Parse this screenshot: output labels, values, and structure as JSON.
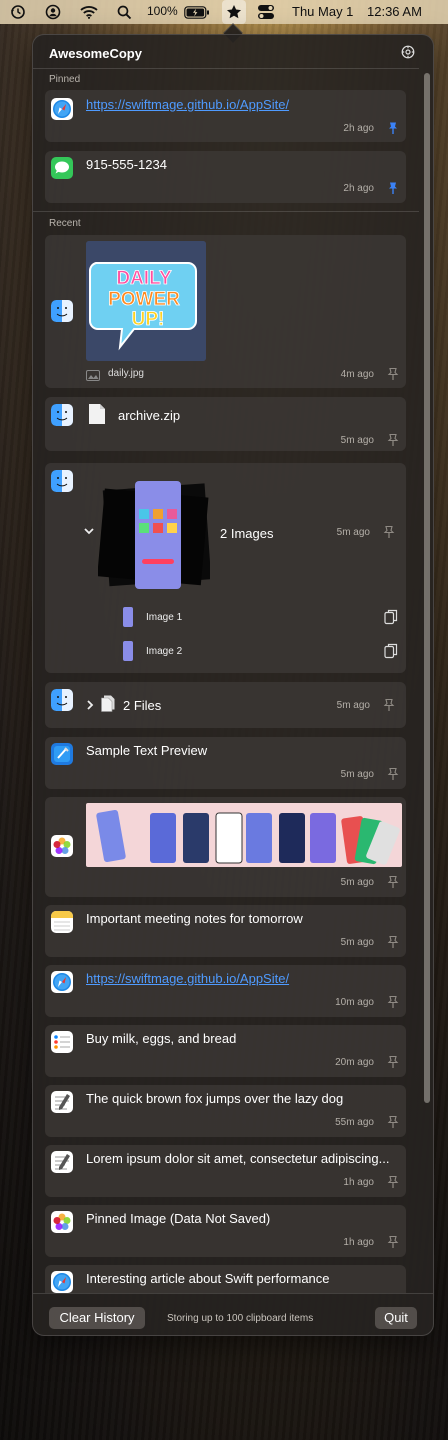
{
  "menubar": {
    "battery": "100%",
    "date": "Thu May 1",
    "time": "12:36 AM"
  },
  "app": {
    "title": "AwesomeCopy"
  },
  "sections": {
    "pinned": "Pinned",
    "recent": "Recent"
  },
  "pinned": [
    {
      "app": "safari",
      "text": "https://swiftmage.github.io/AppSite/",
      "time": "2h ago",
      "pinned": true
    },
    {
      "app": "messages",
      "text": "915-555-1234",
      "time": "2h ago",
      "pinned": true
    }
  ],
  "recent": [
    {
      "app": "finder",
      "kind": "image",
      "image_text": "DAILY POWER UP!",
      "filename": "daily.jpg",
      "time": "4m ago"
    },
    {
      "app": "finder",
      "kind": "file",
      "text": "archive.zip",
      "time": "5m ago"
    },
    {
      "app": "finder",
      "kind": "images-group",
      "text": "2 Images",
      "time": "5m ago",
      "children": [
        "Image 1",
        "Image 2"
      ]
    },
    {
      "app": "finder",
      "kind": "files-group",
      "text": "2 Files",
      "time": "5m ago"
    },
    {
      "app": "xcode",
      "kind": "text",
      "text": "Sample Text Preview",
      "time": "5m ago"
    },
    {
      "app": "photos",
      "kind": "screenshot-strip",
      "time": "5m ago"
    },
    {
      "app": "notes",
      "kind": "text",
      "text": "Important meeting notes for tomorrow",
      "time": "5m ago"
    },
    {
      "app": "safari",
      "kind": "link",
      "text": "https://swiftmage.github.io/AppSite/",
      "time": "10m ago"
    },
    {
      "app": "reminders",
      "kind": "text",
      "text": "Buy milk, eggs, and bread",
      "time": "20m ago"
    },
    {
      "app": "textedit",
      "kind": "text",
      "text": "The quick brown fox jumps over the lazy dog",
      "time": "55m ago"
    },
    {
      "app": "textedit",
      "kind": "text",
      "text": "Lorem ipsum dolor sit amet, consectetur adipiscing...",
      "time": "1h ago"
    },
    {
      "app": "photos",
      "kind": "text",
      "text": "Pinned Image (Data Not Saved)",
      "time": "1h ago"
    },
    {
      "app": "safari",
      "kind": "text",
      "text": "Interesting article about Swift performance",
      "time": ""
    }
  ],
  "footer": {
    "clear": "Clear History",
    "status": "Storing up to 100 clipboard items",
    "quit": "Quit"
  },
  "colors": {
    "accent_blue": "#3b82f6",
    "link": "#4f9bff",
    "panel_bg": "#262220"
  }
}
